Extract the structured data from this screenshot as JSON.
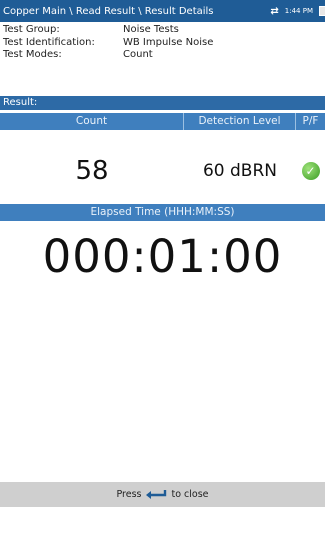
{
  "titlebar": {
    "path": "Copper Main \\ Read Result \\ Result Details",
    "time": "1:44 PM",
    "net_icon": "sync-arrows-icon",
    "battery_icon": "battery-icon"
  },
  "info": {
    "rows": [
      {
        "label": "Test Group:",
        "value": "Noise Tests"
      },
      {
        "label": "Test Identification:",
        "value": "WB Impulse Noise"
      },
      {
        "label": "Test Modes:",
        "value": "Count"
      }
    ]
  },
  "result": {
    "header": "Result:",
    "columns": [
      "Count",
      "Detection Level",
      "P/F"
    ],
    "count": "58",
    "detection_level": "60 dBRN",
    "pass_icon": "check-circle-icon"
  },
  "elapsed": {
    "header": "Elapsed Time (HHH:MM:SS)",
    "value": "000:01:00"
  },
  "footer": {
    "press": "Press",
    "close": "to close",
    "icon": "back-arrow-icon"
  },
  "colors": {
    "titlebar": "#1f5c96",
    "header": "#3f7fbe",
    "pass": "#3a9b22"
  }
}
